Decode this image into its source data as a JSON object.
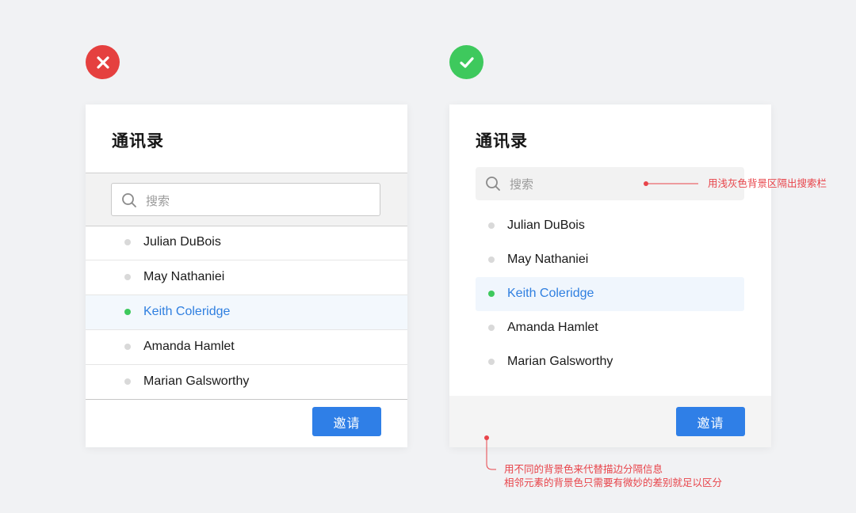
{
  "left_card": {
    "title": "通讯录",
    "search_placeholder": "搜索",
    "contacts": [
      {
        "name": "Julian DuBois"
      },
      {
        "name": "May Nathaniei"
      },
      {
        "name": "Keith Coleridge"
      },
      {
        "name": "Amanda Hamlet"
      },
      {
        "name": "Marian Galsworthy"
      }
    ],
    "invite_label": "邀请"
  },
  "right_card": {
    "title": "通讯录",
    "search_placeholder": "搜索",
    "contacts": [
      {
        "name": "Julian DuBois"
      },
      {
        "name": "May Nathaniei"
      },
      {
        "name": "Keith Coleridge"
      },
      {
        "name": "Amanda Hamlet"
      },
      {
        "name": "Marian Galsworthy"
      }
    ],
    "invite_label": "邀请"
  },
  "annotations": {
    "search_note": "用浅灰色背景区隔出搜索栏",
    "bg_note_line1": "用不同的背景色来代替描边分隔信息",
    "bg_note_line2": "相邻元素的背景色只需要有微妙的差别就足以区分"
  },
  "icons": {
    "bad_badge": "close-icon",
    "good_badge": "check-icon",
    "search": "search-icon"
  },
  "colors": {
    "primary": "#2f7fe7",
    "active_text": "#2f7fe0",
    "online_dot": "#3ec95d",
    "offline_dot": "#d9d9d9",
    "error_red": "#e5403f",
    "success_green": "#3ec95d",
    "annotation_red": "#e8444a"
  }
}
